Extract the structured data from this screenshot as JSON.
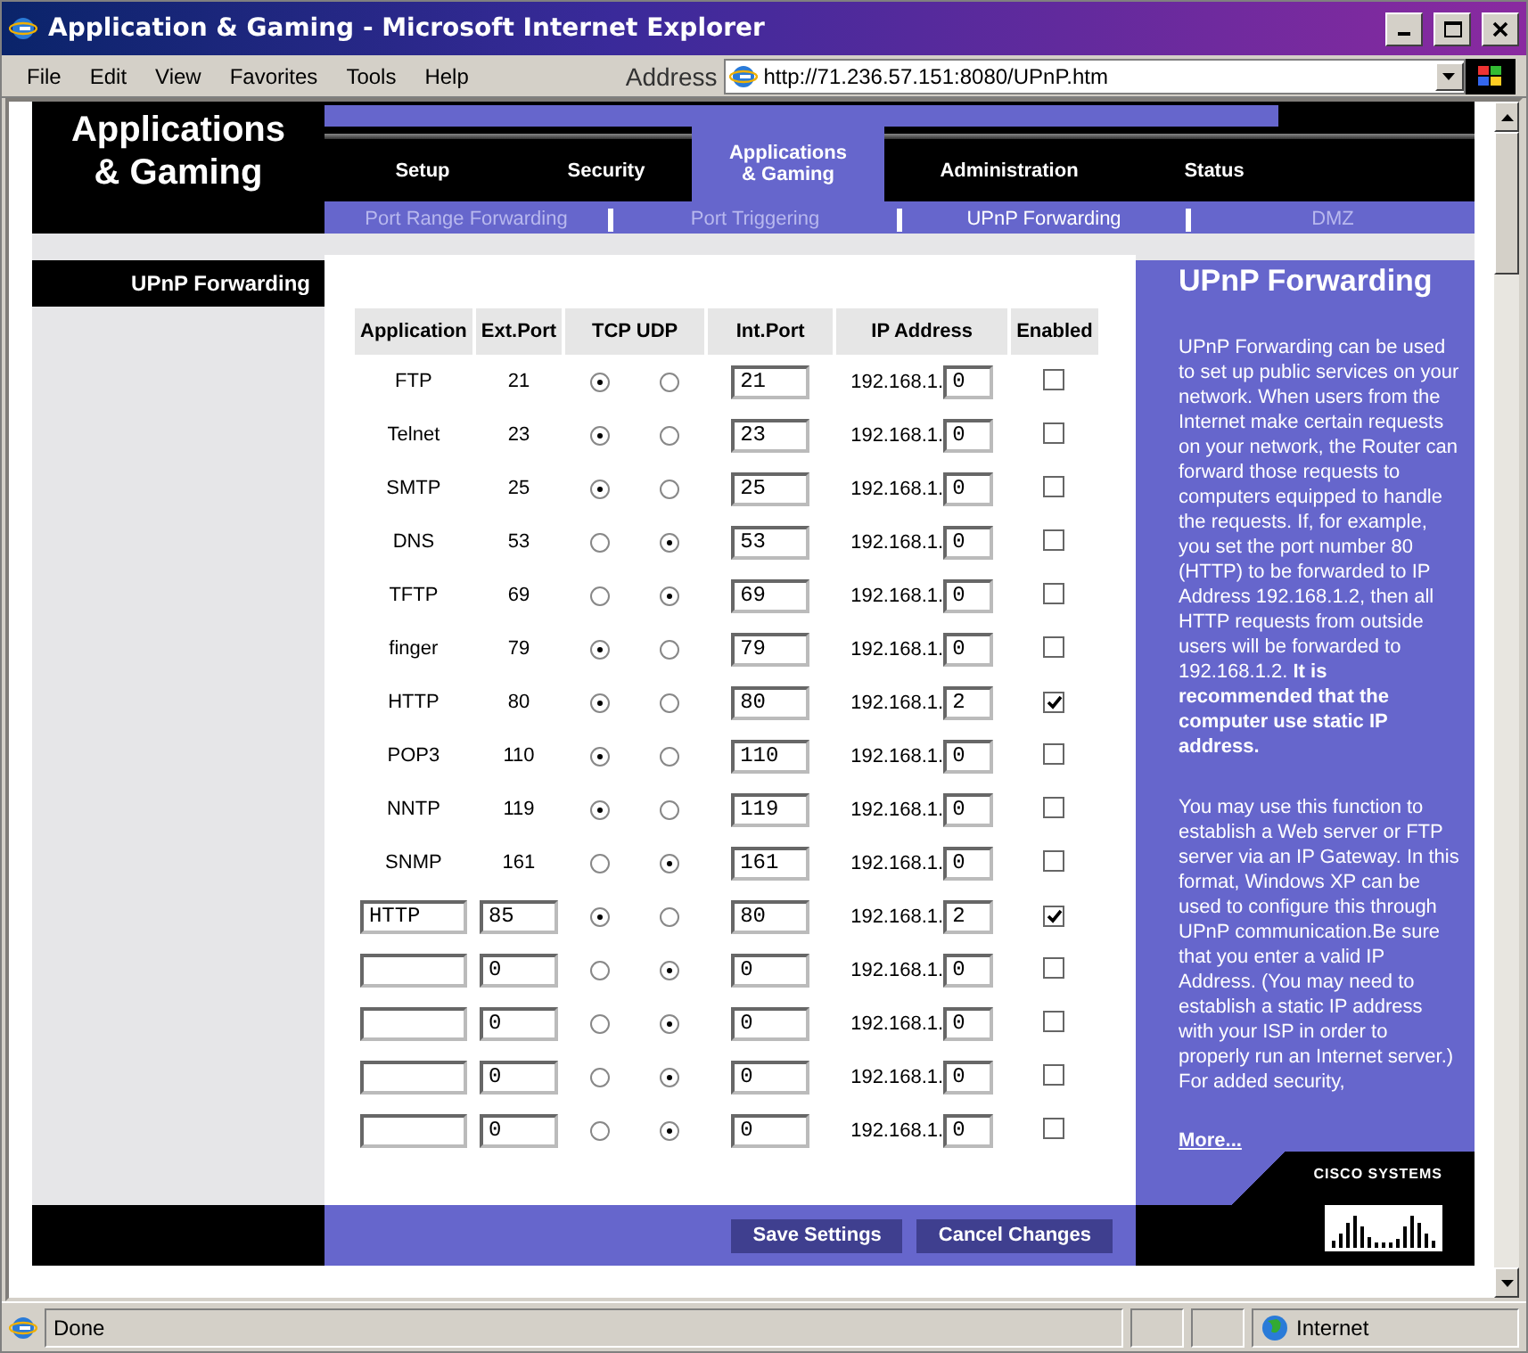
{
  "window": {
    "title": "Application & Gaming - Microsoft Internet Explorer"
  },
  "menu": [
    "File",
    "Edit",
    "View",
    "Favorites",
    "Tools",
    "Help"
  ],
  "address": {
    "label": "Address",
    "value": "http://71.236.57.151:8080/UPnP.htm"
  },
  "page_title": [
    "Applications",
    "& Gaming"
  ],
  "tabs": [
    {
      "label": "Setup",
      "selected": false
    },
    {
      "label": "Security",
      "selected": false
    },
    {
      "label": "Applications & Gaming",
      "selected": true
    },
    {
      "label": "Administration",
      "selected": false
    },
    {
      "label": "Status",
      "selected": false
    }
  ],
  "subtabs": [
    {
      "label": "Port Range Forwarding",
      "selected": false
    },
    {
      "label": "Port Triggering",
      "selected": false
    },
    {
      "label": "UPnP Forwarding",
      "selected": true
    },
    {
      "label": "DMZ",
      "selected": false
    }
  ],
  "sidebar": {
    "label": "UPnP Forwarding"
  },
  "table": {
    "columns": [
      "Application",
      "Ext.Port",
      "TCP",
      "UDP",
      "Int.Port",
      "IP Address",
      "Enabled"
    ],
    "rows": [
      {
        "kind": "preset",
        "application": "FTP",
        "ext_port": "21",
        "tcp": {
          "selected": true
        },
        "udp": {
          "selected": false
        },
        "int_port": "21",
        "ip_prefix": "192.168.1.",
        "ip_last": "0",
        "enabled": false
      },
      {
        "kind": "preset",
        "application": "Telnet",
        "ext_port": "23",
        "tcp": {
          "selected": true
        },
        "udp": {
          "selected": false
        },
        "int_port": "23",
        "ip_prefix": "192.168.1.",
        "ip_last": "0",
        "enabled": false
      },
      {
        "kind": "preset",
        "application": "SMTP",
        "ext_port": "25",
        "tcp": {
          "selected": true
        },
        "udp": {
          "selected": false
        },
        "int_port": "25",
        "ip_prefix": "192.168.1.",
        "ip_last": "0",
        "enabled": false
      },
      {
        "kind": "preset",
        "application": "DNS",
        "ext_port": "53",
        "tcp": {
          "selected": false
        },
        "udp": {
          "selected": true
        },
        "int_port": "53",
        "ip_prefix": "192.168.1.",
        "ip_last": "0",
        "enabled": false
      },
      {
        "kind": "preset",
        "application": "TFTP",
        "ext_port": "69",
        "tcp": {
          "selected": false
        },
        "udp": {
          "selected": true
        },
        "int_port": "69",
        "ip_prefix": "192.168.1.",
        "ip_last": "0",
        "enabled": false
      },
      {
        "kind": "preset",
        "application": "finger",
        "ext_port": "79",
        "tcp": {
          "selected": true
        },
        "udp": {
          "selected": false
        },
        "int_port": "79",
        "ip_prefix": "192.168.1.",
        "ip_last": "0",
        "enabled": false
      },
      {
        "kind": "preset",
        "application": "HTTP",
        "ext_port": "80",
        "tcp": {
          "selected": true
        },
        "udp": {
          "selected": false
        },
        "int_port": "80",
        "ip_prefix": "192.168.1.",
        "ip_last": "2",
        "enabled": true
      },
      {
        "kind": "preset",
        "application": "POP3",
        "ext_port": "110",
        "tcp": {
          "selected": true
        },
        "udp": {
          "selected": false
        },
        "int_port": "110",
        "ip_prefix": "192.168.1.",
        "ip_last": "0",
        "enabled": false
      },
      {
        "kind": "preset",
        "application": "NNTP",
        "ext_port": "119",
        "tcp": {
          "selected": true
        },
        "udp": {
          "selected": false
        },
        "int_port": "119",
        "ip_prefix": "192.168.1.",
        "ip_last": "0",
        "enabled": false
      },
      {
        "kind": "preset",
        "application": "SNMP",
        "ext_port": "161",
        "tcp": {
          "selected": false
        },
        "udp": {
          "selected": true
        },
        "int_port": "161",
        "ip_prefix": "192.168.1.",
        "ip_last": "0",
        "enabled": false
      },
      {
        "kind": "custom",
        "application": "HTTP",
        "ext_port": "85",
        "tcp": {
          "selected": true
        },
        "udp": {
          "selected": false
        },
        "int_port": "80",
        "ip_prefix": "192.168.1.",
        "ip_last": "2",
        "enabled": true
      },
      {
        "kind": "custom",
        "ext_port": "0",
        "tcp": {
          "selected": false
        },
        "udp": {
          "selected": true
        },
        "int_port": "0",
        "ip_prefix": "192.168.1.",
        "ip_last": "0",
        "enabled": false
      },
      {
        "kind": "custom",
        "ext_port": "0",
        "tcp": {
          "selected": false
        },
        "udp": {
          "selected": true
        },
        "int_port": "0",
        "ip_prefix": "192.168.1.",
        "ip_last": "0",
        "enabled": false
      },
      {
        "kind": "custom",
        "ext_port": "0",
        "tcp": {
          "selected": false
        },
        "udp": {
          "selected": true
        },
        "int_port": "0",
        "ip_prefix": "192.168.1.",
        "ip_last": "0",
        "enabled": false
      },
      {
        "kind": "custom",
        "ext_port": "0",
        "tcp": {
          "selected": false
        },
        "udp": {
          "selected": true
        },
        "int_port": "0",
        "ip_prefix": "192.168.1.",
        "ip_last": "0",
        "enabled": false
      }
    ]
  },
  "help": {
    "title": "UPnP Forwarding",
    "paragraphs": [
      "UPnP Forwarding can be used to set up public services on your network. When users from the Internet make certain requests on your network, the Router can forward those requests to computers equipped to handle the requests. If, for example, you set the port number 80 (HTTP) to be forwarded to IP Address 192.168.1.2, then all HTTP requests from outside users will be forwarded to 192.168.1.2. **It is recommended that the computer use static IP address.**",
      "You may use this function to establish a Web server or FTP server via an IP Gateway. In this format, Windows XP can be used to configure this through UPnP communication.Be sure that you enter a valid IP Address. (You may need to establish a static IP address with your ISP in order to properly run an Internet server.) For added security,"
    ],
    "more": "More...",
    "logo": "CISCO SYSTEMS"
  },
  "buttons": [
    "Save Settings",
    "Cancel Changes"
  ],
  "status_bar": {
    "text": "Done",
    "zone": "Internet"
  }
}
